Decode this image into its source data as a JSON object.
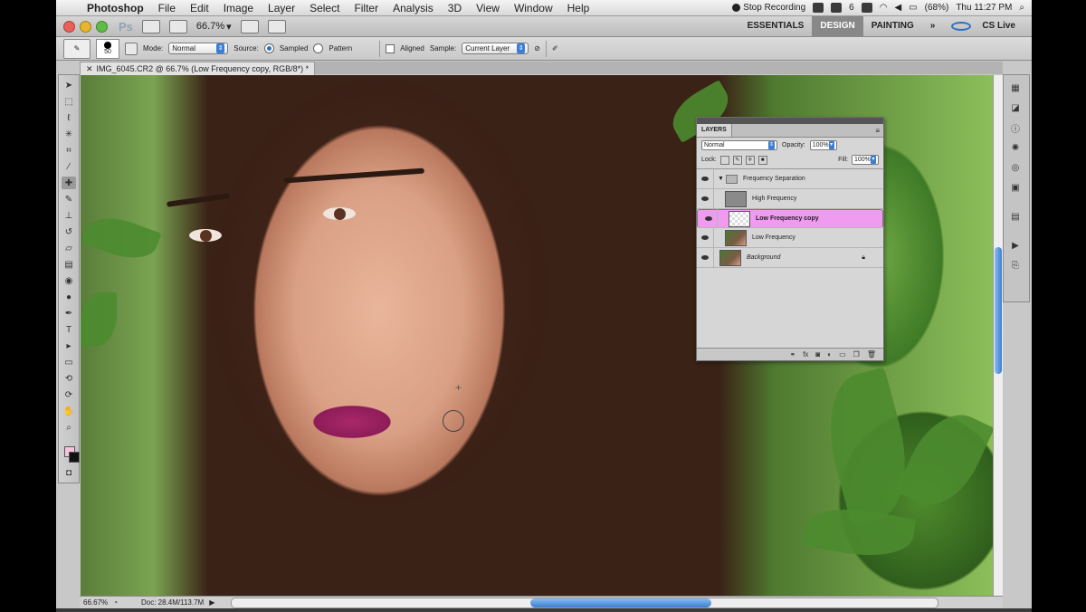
{
  "menubar": {
    "app_name": "Photoshop",
    "items": [
      "File",
      "Edit",
      "Image",
      "Layer",
      "Select",
      "Filter",
      "Analysis",
      "3D",
      "View",
      "Window",
      "Help"
    ],
    "stop_recording": "Stop Recording",
    "tray_number": "6",
    "battery": "(68%)",
    "clock": "Thu 11:27 PM"
  },
  "appbar": {
    "logo": "Ps",
    "zoom": "66.7%",
    "workspaces": [
      "ESSENTIALS",
      "DESIGN",
      "PAINTING"
    ],
    "active_workspace": "DESIGN",
    "more": "»",
    "cs_live": "CS Live"
  },
  "options": {
    "brush_size": "50",
    "mode_label": "Mode:",
    "mode_value": "Normal",
    "source_label": "Source:",
    "sampled": "Sampled",
    "pattern": "Pattern",
    "aligned": "Aligned",
    "sample_label": "Sample:",
    "sample_value": "Current Layer"
  },
  "document": {
    "tab_title": "IMG_6045.CR2 @ 66.7% (Low Frequency copy, RGB/8*) *"
  },
  "status": {
    "zoom": "66.67%",
    "doc_size": "Doc: 28.4M/113.7M"
  },
  "layers_panel": {
    "title": "LAYERS",
    "blend_mode": "Normal",
    "opacity_label": "Opacity:",
    "opacity": "100%",
    "lock_label": "Lock:",
    "fill_label": "Fill:",
    "fill": "100%",
    "group_name": "Frequency Separation",
    "layers": [
      {
        "name": "High Frequency",
        "thumb": "#8a8a8a"
      },
      {
        "name": "Low Frequency copy",
        "thumb": "#e8e8e8"
      },
      {
        "name": "Low Frequency",
        "thumb": "#7a5a45"
      }
    ],
    "background": "Background",
    "footer_icons": [
      "link-icon",
      "fx-icon",
      "mask-icon",
      "adjustment-icon",
      "folder-icon",
      "new-layer-icon",
      "trash-icon"
    ]
  },
  "colors": {
    "selected_layer": "#f09bf0",
    "foreground": "#f6c4de",
    "accent": "#3b7ed6"
  }
}
